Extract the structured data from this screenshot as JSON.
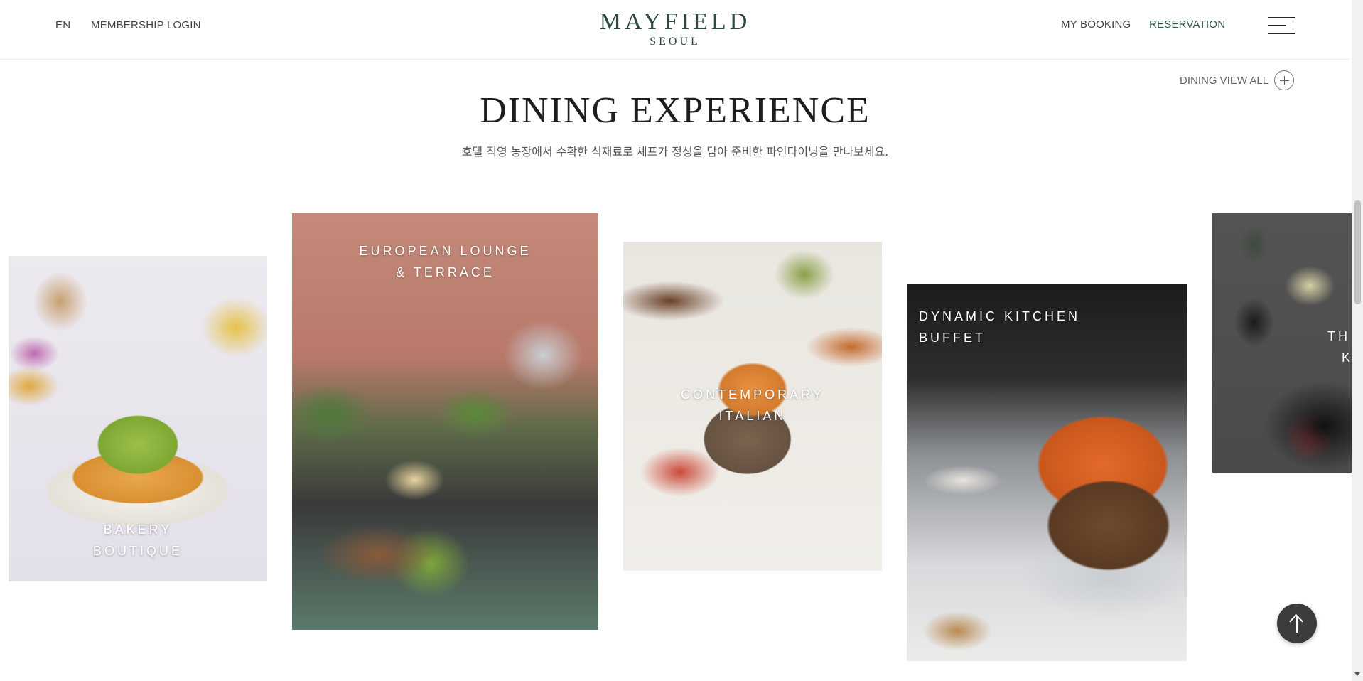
{
  "header": {
    "language": "EN",
    "membership_login": "MEMBERSHIP LOGIN",
    "logo_main": "MAYFIELD",
    "logo_sub": "SEOUL",
    "my_booking": "MY BOOKING",
    "reservation": "RESERVATION",
    "menu_icon": "hamburger-menu-icon",
    "brand_color": "#2c4a3e"
  },
  "section": {
    "view_all": "DINING VIEW ALL",
    "view_all_icon": "plus-circle-icon",
    "title": "DINING EXPERIENCE",
    "subtitle": "호텔 직영 농장에서 수확한 식재료로 셰프가 정성을 담아 준비한 파인다이닝을 만나보세요."
  },
  "cards": [
    {
      "line1": "BAKERY",
      "line2": "BOUTIQUE"
    },
    {
      "line1": "EUROPEAN LOUNGE",
      "line2": "& TERRACE"
    },
    {
      "line1": "CONTEMPORARY",
      "line2": "ITALIAN"
    },
    {
      "line1": "DYNAMIC KITCHEN",
      "line2": "BUFFET"
    },
    {
      "line1": "TH",
      "line2": "K"
    }
  ],
  "scroll_top_icon": "arrow-up-icon"
}
